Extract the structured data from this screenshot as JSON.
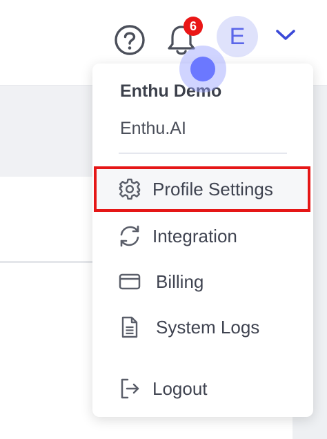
{
  "header": {
    "help_icon": "help-circle-icon",
    "bell_icon": "bell-icon",
    "notification_count": "6",
    "avatar_initial": "E",
    "chevron_icon": "chevron-down-icon"
  },
  "user_menu": {
    "user_name": "Enthu Demo",
    "organization": "Enthu.AI",
    "items": [
      {
        "label": "Profile Settings",
        "icon": "gear-icon",
        "highlighted": true
      },
      {
        "label": "Integration",
        "icon": "sync-icon"
      },
      {
        "label": "Billing",
        "icon": "credit-card-icon"
      },
      {
        "label": "System Logs",
        "icon": "document-icon"
      },
      {
        "label": "Logout",
        "icon": "logout-icon"
      }
    ]
  },
  "colors": {
    "badge": "#ea1616",
    "avatar_bg": "#dfe2fb",
    "accent": "#3b4ad8",
    "highlight_border": "#e51616"
  }
}
